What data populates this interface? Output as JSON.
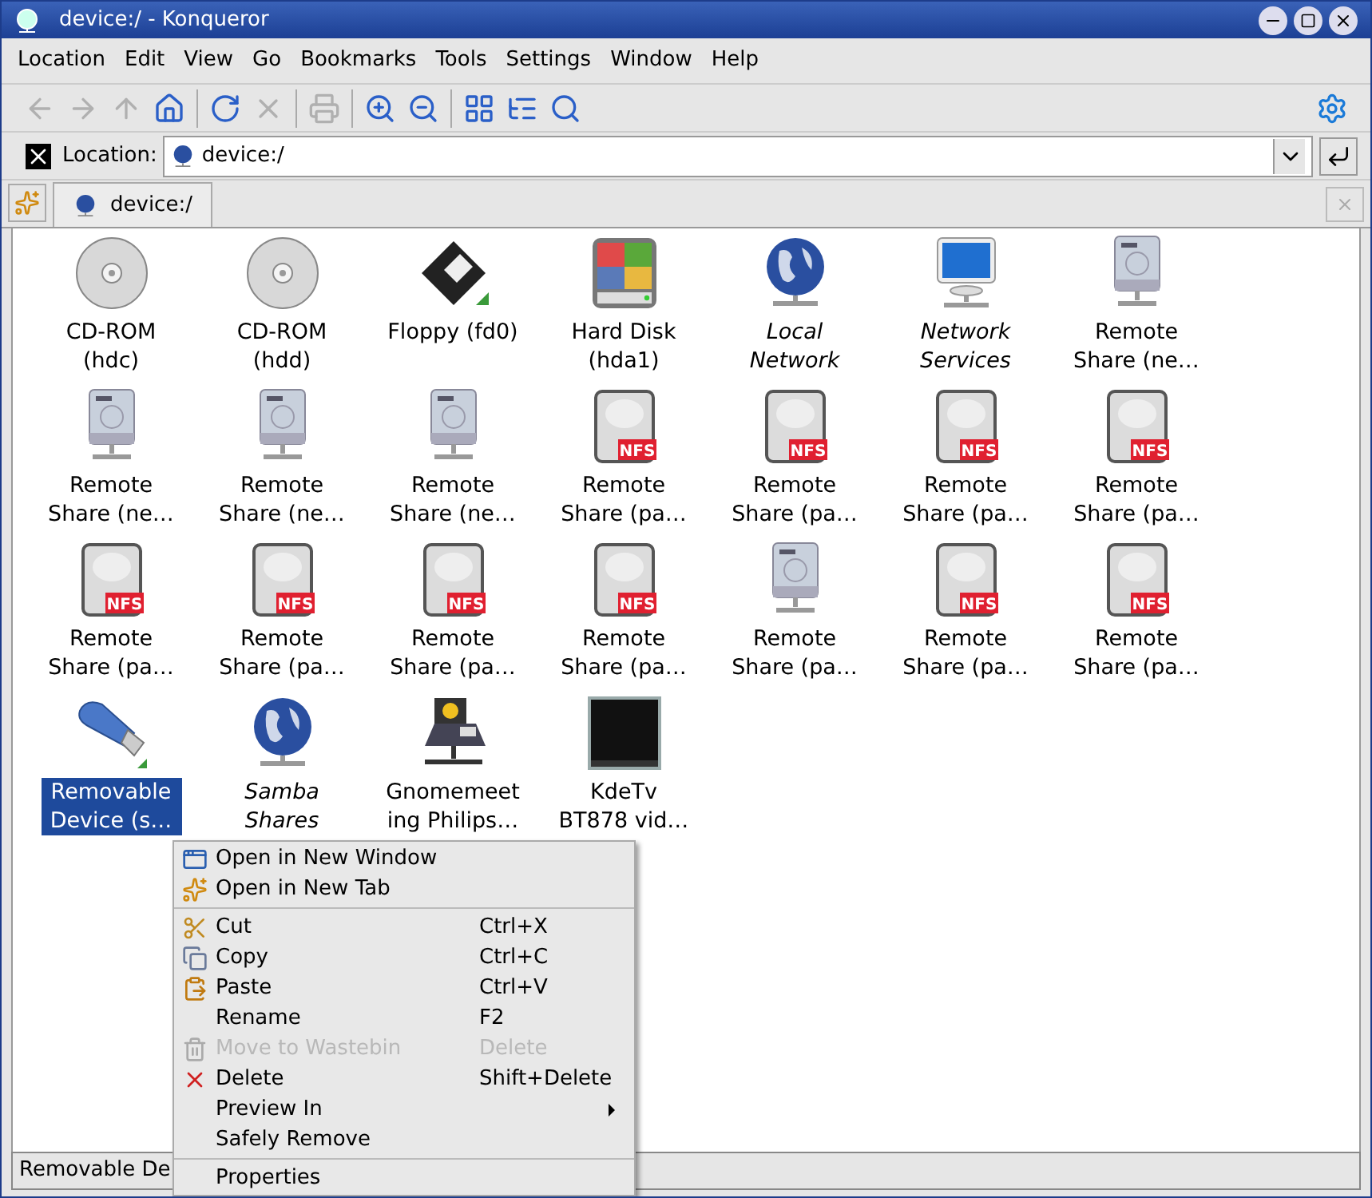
{
  "window": {
    "title": "device:/ - Konqueror"
  },
  "menu_bar": [
    "Location",
    "Edit",
    "View",
    "Go",
    "Bookmarks",
    "Tools",
    "Settings",
    "Window",
    "Help"
  ],
  "toolbar": [
    {
      "kind": "back",
      "disabled": true
    },
    {
      "kind": "forward",
      "disabled": true
    },
    {
      "kind": "up",
      "disabled": true
    },
    {
      "kind": "home",
      "disabled": false
    },
    {
      "kind": "sep"
    },
    {
      "kind": "reload",
      "disabled": false
    },
    {
      "kind": "stop",
      "disabled": true
    },
    {
      "kind": "sep"
    },
    {
      "kind": "print",
      "disabled": true
    },
    {
      "kind": "sep"
    },
    {
      "kind": "zoom-in",
      "disabled": false
    },
    {
      "kind": "zoom-out",
      "disabled": false
    },
    {
      "kind": "sep"
    },
    {
      "kind": "icon-view",
      "disabled": false
    },
    {
      "kind": "tree-view",
      "disabled": false
    },
    {
      "kind": "preview",
      "disabled": false
    }
  ],
  "location_bar": {
    "label": "Location:",
    "value": "device:/"
  },
  "tabs": [
    {
      "label": "device:/",
      "selected": true
    }
  ],
  "items": [
    {
      "kind": "cdrom",
      "label": "CD-ROM (hdc)",
      "italic": false,
      "selected": false
    },
    {
      "kind": "cdrom",
      "label": "CD-ROM (hdd)",
      "italic": false,
      "selected": false
    },
    {
      "kind": "floppy",
      "label": "Floppy (fd0)",
      "italic": false,
      "selected": false
    },
    {
      "kind": "harddisk",
      "label": "Hard Disk (hda1)",
      "italic": false,
      "selected": false
    },
    {
      "kind": "globe",
      "label": "Local Network",
      "italic": true,
      "selected": false
    },
    {
      "kind": "monitor",
      "label": "Network Services",
      "italic": true,
      "selected": false
    },
    {
      "kind": "share",
      "label": "Remote Share (ne…",
      "italic": false,
      "selected": false
    },
    {
      "kind": "share",
      "label": "Remote Share (ne…",
      "italic": false,
      "selected": false
    },
    {
      "kind": "share",
      "label": "Remote Share (ne…",
      "italic": false,
      "selected": false
    },
    {
      "kind": "share",
      "label": "Remote Share (ne…",
      "italic": false,
      "selected": false
    },
    {
      "kind": "nfs",
      "badge": "NFS",
      "label": "Remote Share (pa…",
      "italic": false,
      "selected": false
    },
    {
      "kind": "nfs",
      "badge": "NFS",
      "label": "Remote Share (pa…",
      "italic": false,
      "selected": false
    },
    {
      "kind": "nfs",
      "badge": "NFS",
      "label": "Remote Share (pa…",
      "italic": false,
      "selected": false
    },
    {
      "kind": "nfs",
      "badge": "NFS",
      "label": "Remote Share (pa…",
      "italic": false,
      "selected": false
    },
    {
      "kind": "nfs",
      "badge": "NFS",
      "label": "Remote Share (pa…",
      "italic": false,
      "selected": false
    },
    {
      "kind": "nfs",
      "badge": "NFS",
      "label": "Remote Share (pa…",
      "italic": false,
      "selected": false
    },
    {
      "kind": "nfs",
      "badge": "NFS",
      "label": "Remote Share (pa…",
      "italic": false,
      "selected": false
    },
    {
      "kind": "nfs",
      "badge": "NFS",
      "label": "Remote Share (pa…",
      "italic": false,
      "selected": false
    },
    {
      "kind": "share",
      "label": "Remote Share (pa…",
      "italic": false,
      "selected": false
    },
    {
      "kind": "nfs",
      "badge": "NFS",
      "label": "Remote Share (pa…",
      "italic": false,
      "selected": false
    },
    {
      "kind": "nfs",
      "badge": "NFS",
      "label": "Remote Share (pa…",
      "italic": false,
      "selected": false
    },
    {
      "kind": "usb",
      "label": "Removable Device (s…",
      "italic": false,
      "selected": true
    },
    {
      "kind": "globe",
      "label": "Samba Shares",
      "italic": true,
      "selected": false
    },
    {
      "kind": "phone",
      "label": "Gnomemeet ing Philips…",
      "italic": false,
      "selected": false
    },
    {
      "kind": "tv",
      "label": "KdeTv BT878 vid…",
      "italic": false,
      "selected": false
    }
  ],
  "context_menu": [
    {
      "kind": "item",
      "label": "Open in New Window",
      "disabled": false
    },
    {
      "kind": "item",
      "label": "Open in New Tab",
      "disabled": false
    },
    {
      "kind": "separator"
    },
    {
      "kind": "item",
      "label": "Cut",
      "shortcut": "Ctrl+X",
      "disabled": false
    },
    {
      "kind": "item",
      "label": "Copy",
      "shortcut": "Ctrl+C",
      "disabled": false
    },
    {
      "kind": "item",
      "label": "Paste",
      "shortcut": "Ctrl+V",
      "disabled": false
    },
    {
      "kind": "item",
      "label": "Rename",
      "shortcut": "F2",
      "disabled": false
    },
    {
      "kind": "item",
      "label": "Move to Wastebin",
      "shortcut": "Delete",
      "disabled": true
    },
    {
      "kind": "item",
      "label": "Delete",
      "shortcut": "Shift+Delete",
      "disabled": false
    },
    {
      "kind": "submenu",
      "label": "Preview In",
      "disabled": false
    },
    {
      "kind": "item",
      "label": "Safely Remove",
      "disabled": false
    },
    {
      "kind": "separator"
    },
    {
      "kind": "item",
      "label": "Properties",
      "disabled": false
    }
  ],
  "status_bar": "Removable De"
}
